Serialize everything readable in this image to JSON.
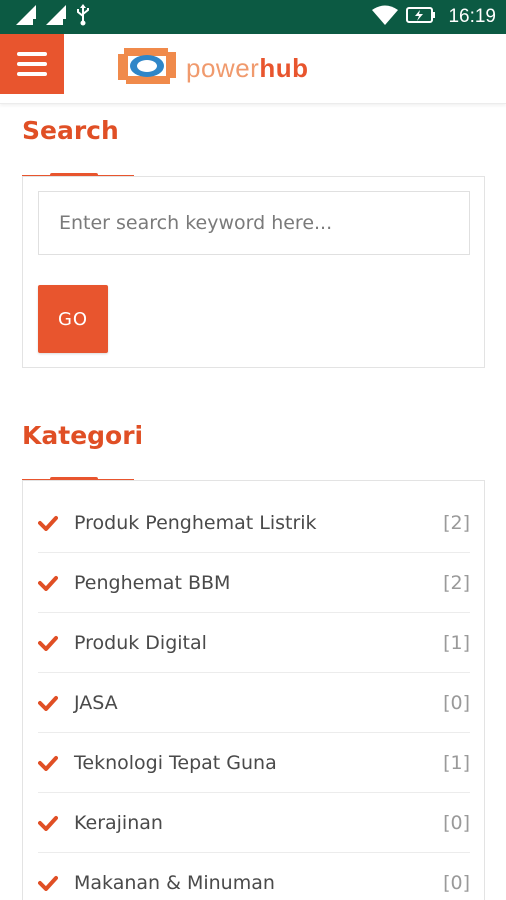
{
  "status_bar": {
    "time": "16:19",
    "icons": [
      "signal-icon",
      "signal-icon",
      "usb-icon",
      "wifi-icon",
      "battery-charging-icon"
    ]
  },
  "header": {
    "logo_text_light": "power",
    "logo_text_bold": "hub"
  },
  "search": {
    "title": "Search",
    "placeholder": "Enter search keyword here...",
    "button_label": "GO"
  },
  "categories": {
    "title": "Kategori",
    "items": [
      {
        "label": "Produk Penghemat Listrik",
        "count": "[2]"
      },
      {
        "label": "Penghemat BBM",
        "count": "[2]"
      },
      {
        "label": "Produk Digital",
        "count": "[1]"
      },
      {
        "label": "JASA",
        "count": "[0]"
      },
      {
        "label": "Teknologi Tepat Guna",
        "count": "[1]"
      },
      {
        "label": "Kerajinan",
        "count": "[0]"
      },
      {
        "label": "Makanan & Minuman",
        "count": "[0]"
      }
    ]
  },
  "colors": {
    "accent": "#e8552e",
    "status_bar": "#0c5a43",
    "logo_blue": "#2f86c8"
  }
}
